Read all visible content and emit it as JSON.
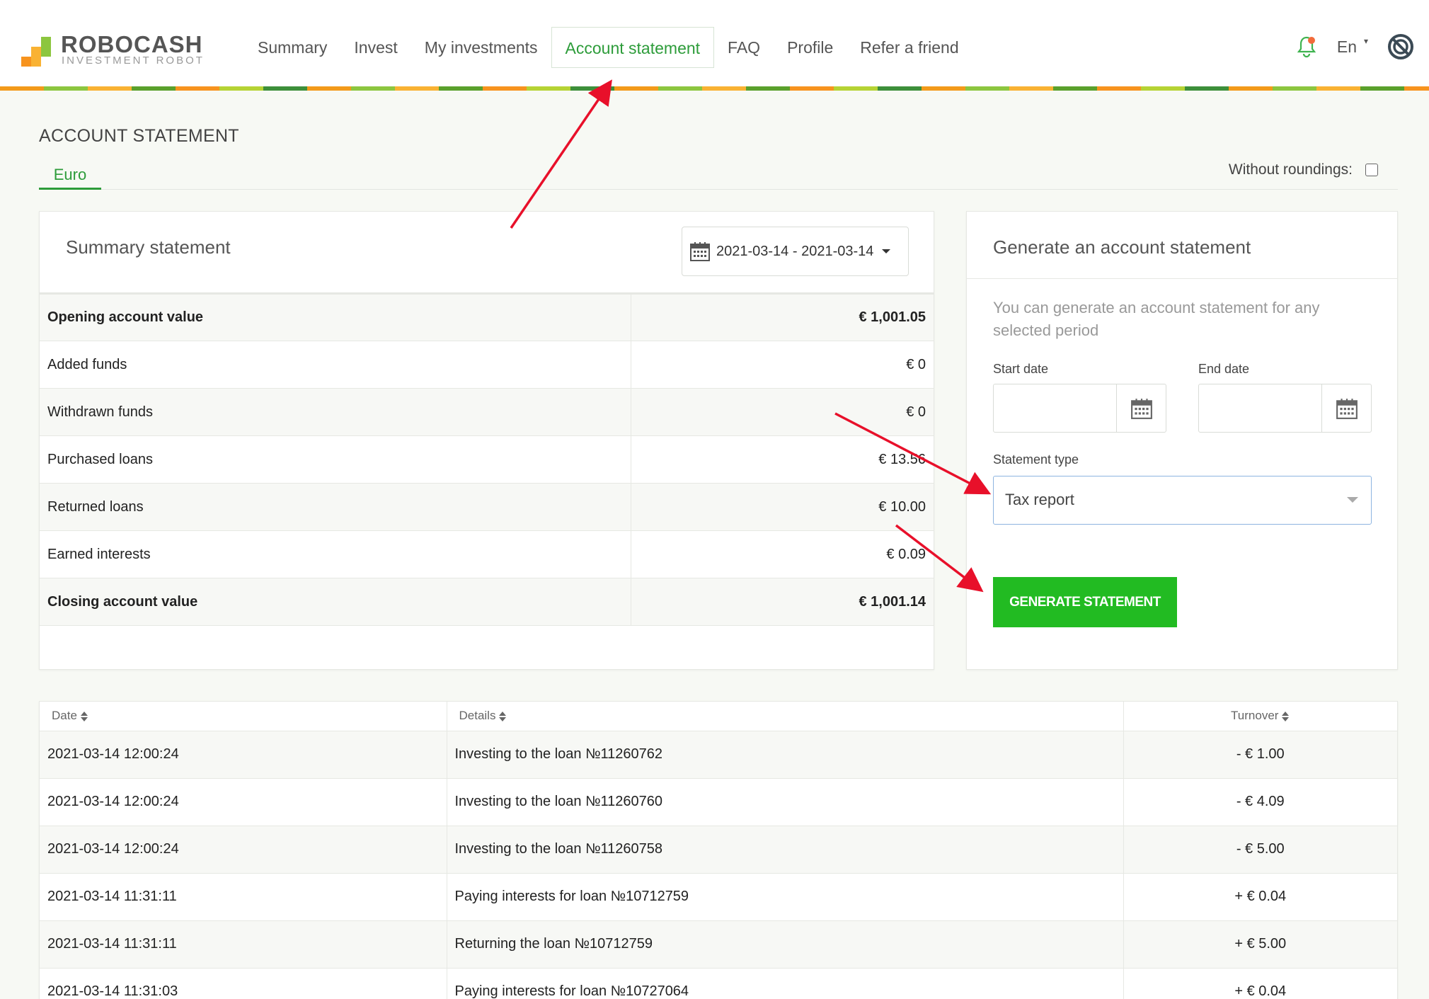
{
  "brand": {
    "name": "ROBOCASH",
    "tagline": "INVESTMENT ROBOT",
    "colors": [
      "#f7931e",
      "#f9b233",
      "#8cc63f",
      "#3d8f3a"
    ]
  },
  "nav": {
    "items": [
      {
        "label": "Summary"
      },
      {
        "label": "Invest"
      },
      {
        "label": "My investments"
      },
      {
        "label": "Account statement",
        "active": true
      },
      {
        "label": "FAQ"
      },
      {
        "label": "Profile"
      },
      {
        "label": "Refer a friend"
      }
    ],
    "language": "En",
    "icons": {
      "notifications": "bell-icon",
      "logout": "power-off-icon"
    }
  },
  "page": {
    "title": "ACCOUNT STATEMENT",
    "tab": "Euro",
    "rounding_label": "Without roundings:",
    "rounding_checked": false
  },
  "summary": {
    "title": "Summary statement",
    "date_range": "2021-03-14 - 2021-03-14",
    "rows": [
      {
        "label": "Opening account value",
        "value": "€ 1,001.05",
        "bold": true
      },
      {
        "label": "Added funds",
        "value": "€ 0"
      },
      {
        "label": "Withdrawn funds",
        "value": "€ 0"
      },
      {
        "label": "Purchased loans",
        "value": "€ 13.56"
      },
      {
        "label": "Returned loans",
        "value": "€ 10.00"
      },
      {
        "label": "Earned interests",
        "value": "€ 0.09"
      },
      {
        "label": "Closing account value",
        "value": "€ 1,001.14",
        "bold": true
      }
    ]
  },
  "generate": {
    "title": "Generate an account statement",
    "description": "You can generate an account statement for any selected period",
    "start_label": "Start date",
    "end_label": "End date",
    "type_label": "Statement type",
    "type_value": "Tax report",
    "button": "GENERATE STATEMENT",
    "button_color": "#22bb22"
  },
  "transactions": {
    "headers": [
      "Date",
      "Details",
      "Turnover"
    ],
    "rows": [
      {
        "date": "2021-03-14 12:00:24",
        "details": "Investing to the loan №11260762",
        "turnover": "- € 1.00",
        "sign": "neg"
      },
      {
        "date": "2021-03-14 12:00:24",
        "details": "Investing to the loan №11260760",
        "turnover": "- € 4.09",
        "sign": "neg"
      },
      {
        "date": "2021-03-14 12:00:24",
        "details": "Investing to the loan №11260758",
        "turnover": "- € 5.00",
        "sign": "neg"
      },
      {
        "date": "2021-03-14 11:31:11",
        "details": "Paying interests for loan №10712759",
        "turnover": "+ € 0.04",
        "sign": "pos"
      },
      {
        "date": "2021-03-14 11:31:11",
        "details": "Returning the loan №10712759",
        "turnover": "+ € 5.00",
        "sign": "pos"
      },
      {
        "date": "2021-03-14 11:31:03",
        "details": "Paying interests for loan №10727064",
        "turnover": "+ € 0.04",
        "sign": "pos"
      }
    ]
  },
  "colors": {
    "accent_green": "#2d9c3a",
    "negative": "#e0182a",
    "arrow": "#e8102a"
  }
}
